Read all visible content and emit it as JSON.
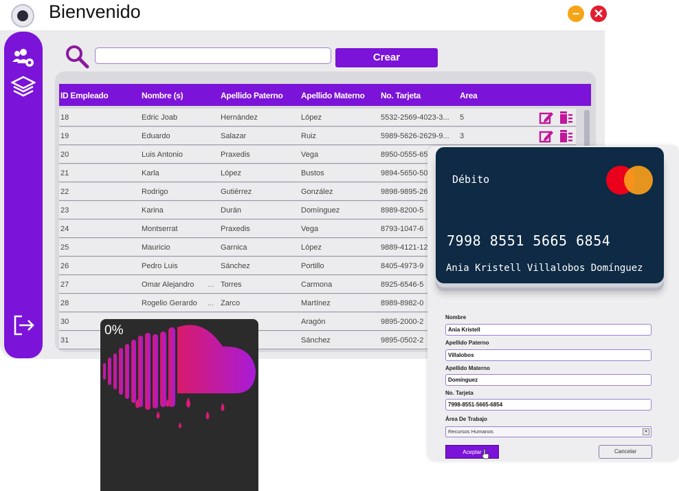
{
  "window": {
    "title": "Bienvenido",
    "min_label": "−",
    "close_label": "✕"
  },
  "toolbar": {
    "search_value": "",
    "crear_label": "Crear"
  },
  "table": {
    "columns": [
      "ID Empleado",
      "Nombre (s)",
      "Apellido Paterno",
      "Apellido Materno",
      "No. Tarjeta",
      "Area"
    ],
    "rows": [
      {
        "id": "18",
        "nombre": "Edric Joab",
        "paterno": "Hernández",
        "materno": "López",
        "tarjeta": "5532-2569-4023-3...",
        "area": "5"
      },
      {
        "id": "19",
        "nombre": "Eduardo",
        "paterno": "Salazar",
        "materno": "Ruiz",
        "tarjeta": "5989-5626-2629-9...",
        "area": "3"
      },
      {
        "id": "20",
        "nombre": "Luis Antonio",
        "paterno": "Praxedis",
        "materno": "Vega",
        "tarjeta": "8950-0555-65",
        "area": ""
      },
      {
        "id": "21",
        "nombre": "Karla",
        "paterno": "López",
        "materno": "Bustos",
        "tarjeta": "9894-5650-50",
        "area": ""
      },
      {
        "id": "22",
        "nombre": "Rodrigo",
        "paterno": "Gutiérrez",
        "materno": "González",
        "tarjeta": "9898-9895-26",
        "area": ""
      },
      {
        "id": "23",
        "nombre": "Karina",
        "paterno": "Durán",
        "materno": "Domínguez",
        "tarjeta": "8989-8200-5",
        "area": ""
      },
      {
        "id": "24",
        "nombre": "Montserrat",
        "paterno": "Praxedis",
        "materno": "Vega",
        "tarjeta": "8793-1047-6",
        "area": ""
      },
      {
        "id": "25",
        "nombre": "Mauricio",
        "paterno": "Garnica",
        "materno": "López",
        "tarjeta": "9889-4121-12",
        "area": ""
      },
      {
        "id": "26",
        "nombre": "Pedro Luis",
        "paterno": "Sánchez",
        "materno": "Portillo",
        "tarjeta": "8405-4973-9",
        "area": ""
      },
      {
        "id": "27",
        "nombre": "Omar Alejandro",
        "paterno": "Torres",
        "materno": "Carmona",
        "tarjeta": "8925-6546-5",
        "area": ""
      },
      {
        "id": "28",
        "nombre": "Rogelio Gerardo",
        "paterno": "Zarco",
        "materno": "Martínez",
        "tarjeta": "8989-8982-0",
        "area": ""
      },
      {
        "id": "30",
        "nombre": "",
        "paterno": "",
        "materno": "Aragón",
        "tarjeta": "9895-2000-2",
        "area": ""
      },
      {
        "id": "31",
        "nombre": "",
        "paterno": "",
        "materno": "Sánchez",
        "tarjeta": "9895-0502-2",
        "area": ""
      }
    ],
    "ellipsis": "..."
  },
  "card": {
    "type": "Débito",
    "number": "7998 8551 5665 6854",
    "holder": "Ania Kristell Villalobos Domínguez"
  },
  "form": {
    "nombre_label": "Nombre",
    "nombre_value": "Ania Kristell",
    "paterno_label": "Apellido Paterno",
    "paterno_value": "Villalobos",
    "materno_label": "Apellido Materno",
    "materno_value": "Domínguez",
    "tarjeta_label": "No. Tarjeta",
    "tarjeta_value": "7998-8551-5665-6854",
    "area_label": "Área De Trabajo",
    "area_value": "Recursos Humanos",
    "aceptar_label": "Aceptar",
    "cancelar_label": "Cancelar"
  },
  "loader": {
    "progress_text": "0%",
    "progress": 0
  },
  "colors": {
    "accent": "#7b13d8",
    "magenta": "#d81b7a",
    "card": "#0e2a44"
  }
}
